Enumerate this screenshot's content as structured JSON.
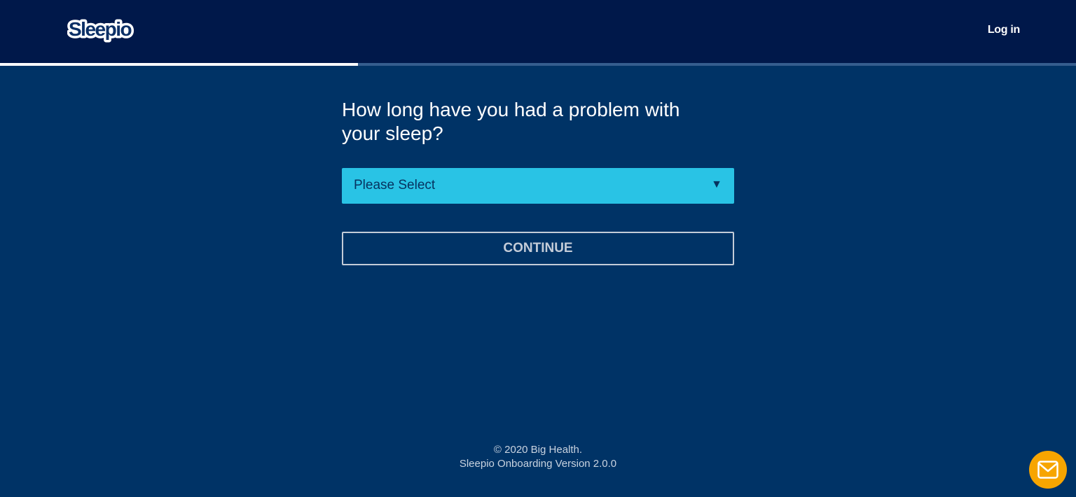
{
  "header": {
    "logo_text": "Sleepio",
    "login_label": "Log in"
  },
  "progress": {
    "fraction": 0.333
  },
  "question": {
    "text": "How long have you had a problem with your sleep?"
  },
  "select": {
    "value": "Please Select",
    "arrow": "▼"
  },
  "continue_button": {
    "label": "CONTINUE"
  },
  "footer": {
    "copyright": "© 2020 Big Health.",
    "version": "Sleepio Onboarding Version 2.0.0"
  },
  "support": {
    "icon": "mail-icon"
  },
  "colors": {
    "background": "#003366",
    "header": "#00184a",
    "select": "#29c3e5",
    "accent": "#f7a500"
  }
}
